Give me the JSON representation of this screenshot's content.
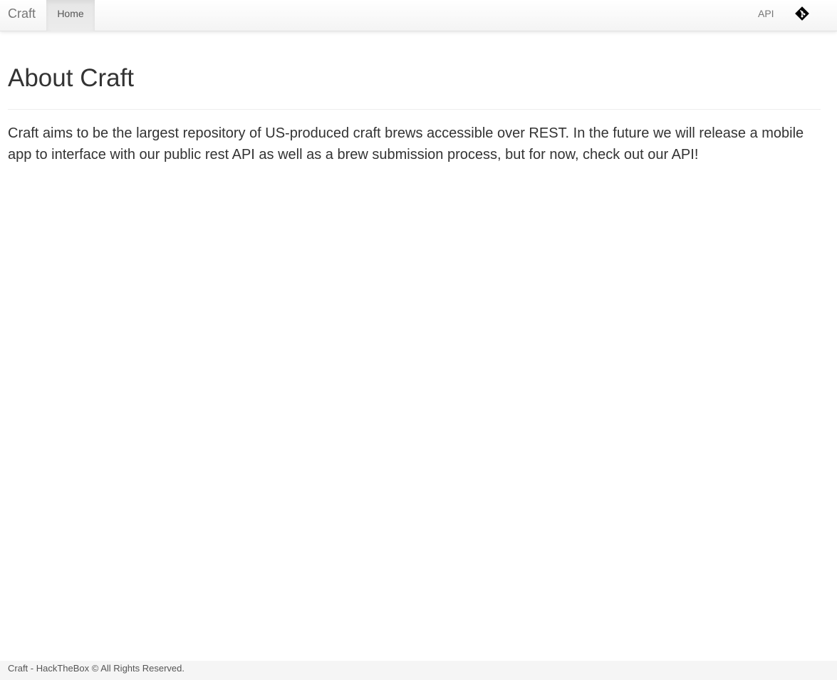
{
  "navbar": {
    "brand": "Craft",
    "home_label": "Home",
    "api_label": "API",
    "git_icon": "git-icon"
  },
  "main": {
    "title": "About Craft",
    "paragraph": "Craft aims to be the largest repository of US-produced craft brews accessible over REST. In the future we will release a mobile app to interface with our public rest API as well as a brew submission process, but for now, check out our API!"
  },
  "footer": {
    "text": "Craft - HackTheBox © All Rights Reserved."
  }
}
